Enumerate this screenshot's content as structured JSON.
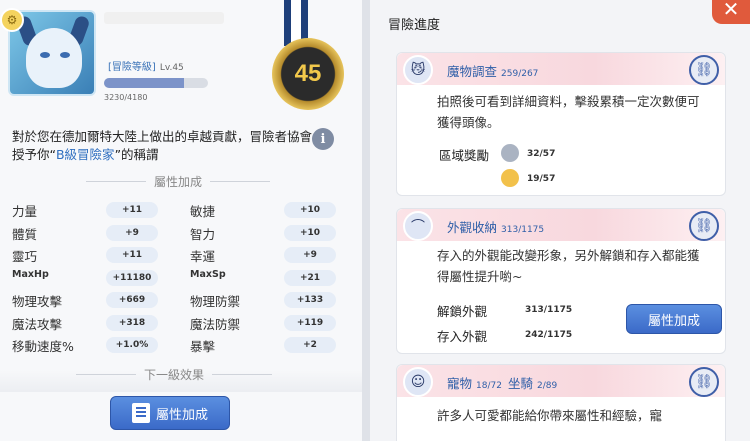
{
  "profile": {
    "rank_label": "[冒險等級]",
    "level_label": "Lv.45",
    "exp_text": "3230/4180",
    "exp_fraction": 0.773,
    "medal_level": "45",
    "description_prefix": "對於您在德加爾特大陸上做出的卓越貢獻，冒險者協會授予你“",
    "description_title": "B級冒險家",
    "description_suffix": "”的稱謂",
    "info_glyph": "i"
  },
  "attributes": {
    "title": "屬性加成",
    "rows": [
      {
        "l_name": "力量",
        "l_val": "+11",
        "r_name": "敏捷",
        "r_val": "+10"
      },
      {
        "l_name": "體質",
        "l_val": "+9",
        "r_name": "智力",
        "r_val": "+10"
      },
      {
        "l_name": "靈巧",
        "l_val": "+11",
        "r_name": "幸運",
        "r_val": "+9"
      },
      {
        "l_name": "MaxHp",
        "l_val": "+11180",
        "r_name": "MaxSp",
        "r_val": "+21"
      },
      {
        "l_name": "物理攻擊",
        "l_val": "+669",
        "r_name": "物理防禦",
        "r_val": "+133"
      },
      {
        "l_name": "魔法攻擊",
        "l_val": "+318",
        "r_name": "魔法防禦",
        "r_val": "+119"
      },
      {
        "l_name": "移動速度%",
        "l_val": "+1.0%",
        "r_name": "暴擊",
        "r_val": "+2"
      }
    ],
    "next_level_title": "下一級效果",
    "button_label": "屬性加成"
  },
  "progress": {
    "title": "冒險進度",
    "close_glyph": "✕",
    "cards": {
      "monster": {
        "title": "魔物調查",
        "count": "259/267",
        "body": "拍照後可看到詳細資料，擊殺累積一定次數便可獲得頭像。",
        "reward_label": "區域獎勵",
        "reward1": "32/57",
        "reward2": "19/57"
      },
      "appearance": {
        "title": "外觀收納",
        "count": "313/1175",
        "body": "存入的外觀能改變形象，另外解鎖和存入都能獲得屬性提升喲~",
        "unlock_label": "解鎖外觀",
        "unlock_val": "313/1175",
        "store_label": "存入外觀",
        "store_val": "242/1175",
        "button_label": "屬性加成"
      },
      "pet": {
        "title": "寵物",
        "count1": "18/72",
        "title2": "坐騎",
        "count2": "2/89",
        "body": "許多人可愛都能給你帶來屬性和經驗，寵"
      }
    }
  }
}
